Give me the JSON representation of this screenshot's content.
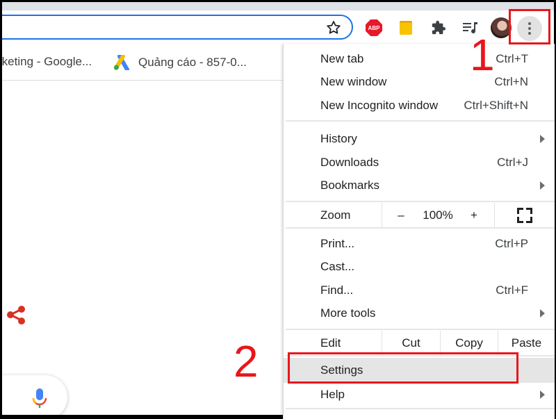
{
  "toolbar": {
    "extensions": [
      {
        "name": "adblock-plus",
        "label": "ABP",
        "color": "#e8182b"
      },
      {
        "name": "sticky-notes",
        "color": "#f8c300"
      },
      {
        "name": "extensions-puzzle"
      },
      {
        "name": "media-control"
      }
    ],
    "menu_button_accent": "#e2e2e2"
  },
  "bookmarks": [
    {
      "label": "rketing - Google...",
      "icon": "none"
    },
    {
      "label": "Quảng cáo - 857-0...",
      "icon": "google-ads-icon"
    }
  ],
  "annotations": {
    "step1": "1",
    "step2": "2",
    "highlight_color": "#e8161b"
  },
  "menu": {
    "new_tab": {
      "label": "New tab",
      "shortcut": "Ctrl+T"
    },
    "new_window": {
      "label": "New window",
      "shortcut": "Ctrl+N"
    },
    "new_incognito": {
      "label": "New Incognito window",
      "shortcut": "Ctrl+Shift+N"
    },
    "history": {
      "label": "History"
    },
    "downloads": {
      "label": "Downloads",
      "shortcut": "Ctrl+J"
    },
    "bookmarks": {
      "label": "Bookmarks"
    },
    "zoom": {
      "label": "Zoom",
      "minus": "–",
      "value": "100%",
      "plus": "+"
    },
    "print": {
      "label": "Print...",
      "shortcut": "Ctrl+P"
    },
    "cast": {
      "label": "Cast..."
    },
    "find": {
      "label": "Find...",
      "shortcut": "Ctrl+F"
    },
    "more_tools": {
      "label": "More tools"
    },
    "edit": {
      "label": "Edit",
      "cut": "Cut",
      "copy": "Copy",
      "paste": "Paste"
    },
    "settings": {
      "label": "Settings"
    },
    "help": {
      "label": "Help"
    }
  }
}
